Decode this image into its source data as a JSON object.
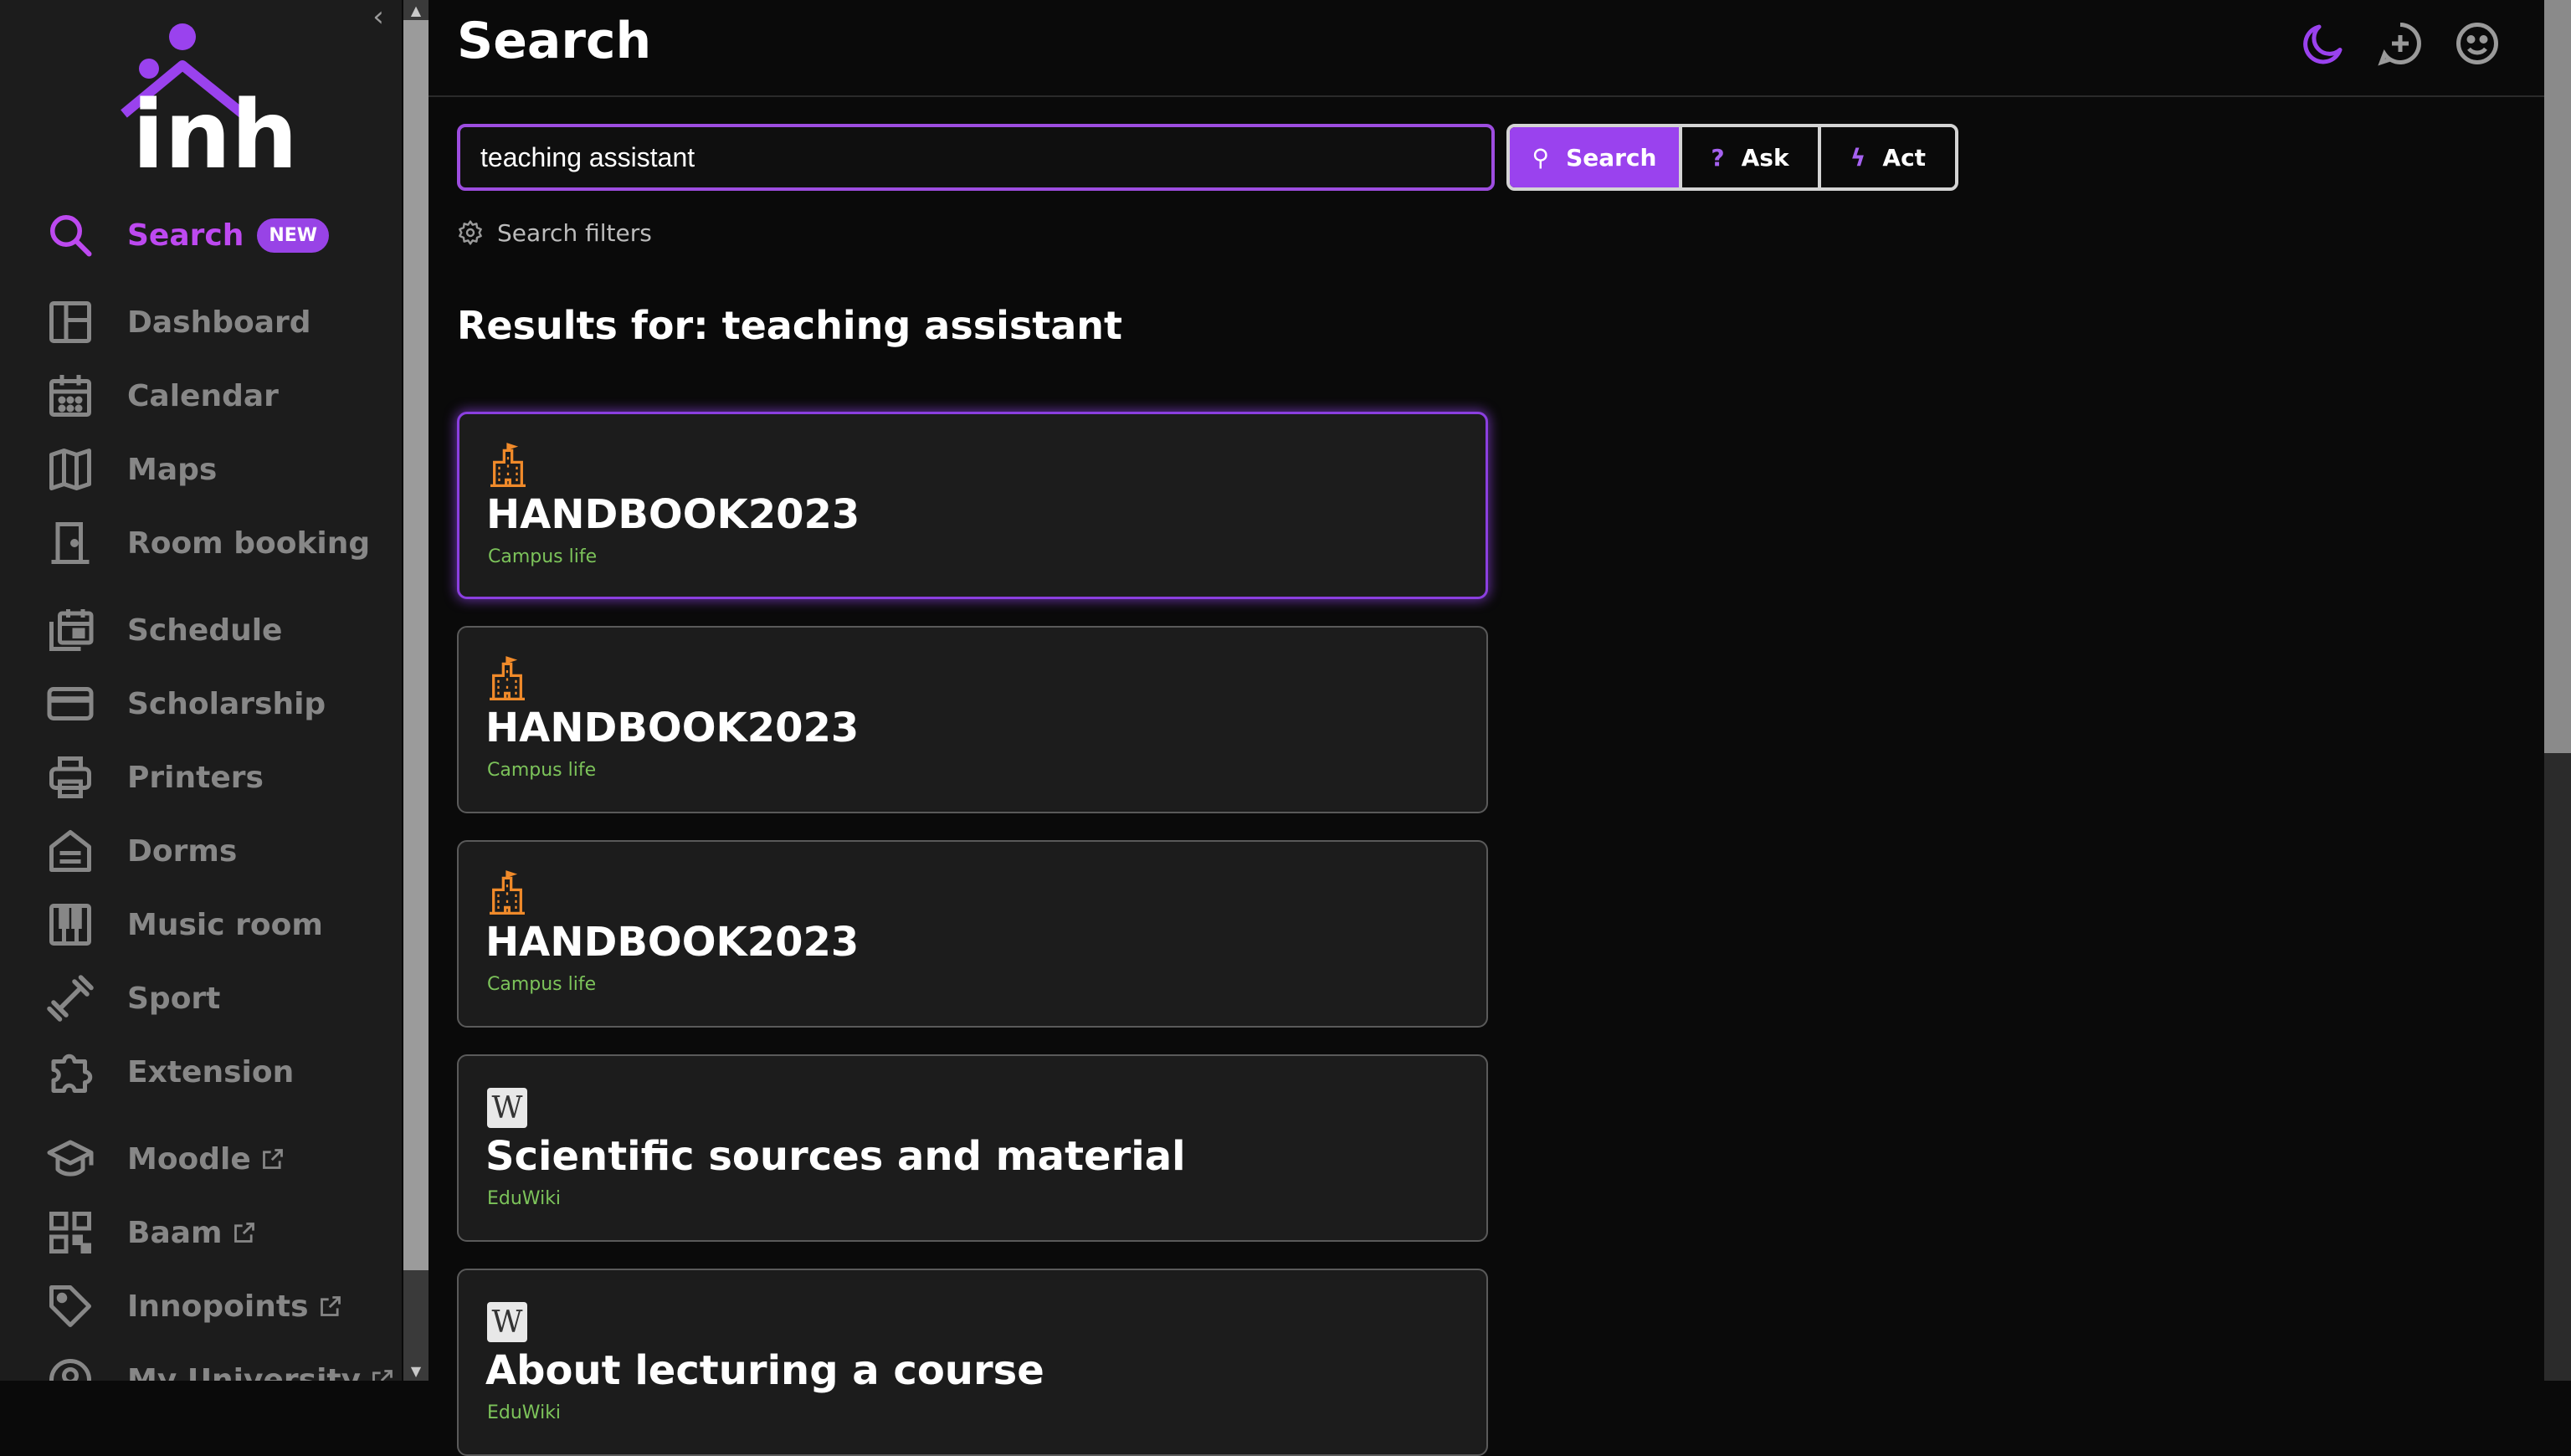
{
  "sidebar": {
    "collapse_glyph": "‹",
    "logo_text": "inh",
    "items": [
      {
        "label": "Search",
        "icon": "search-icon",
        "active": true,
        "badge": "NEW"
      },
      {
        "label": "Dashboard",
        "icon": "dashboard-icon"
      },
      {
        "label": "Calendar",
        "icon": "calendar-icon"
      },
      {
        "label": "Maps",
        "icon": "map-icon"
      },
      {
        "label": "Room booking",
        "icon": "door-icon"
      },
      {
        "label": "Schedule",
        "icon": "schedule-icon"
      },
      {
        "label": "Scholarship",
        "icon": "card-icon"
      },
      {
        "label": "Printers",
        "icon": "printer-icon"
      },
      {
        "label": "Dorms",
        "icon": "dorm-icon"
      },
      {
        "label": "Music room",
        "icon": "piano-icon"
      },
      {
        "label": "Sport",
        "icon": "dumbbell-icon"
      },
      {
        "label": "Extension",
        "icon": "puzzle-icon"
      },
      {
        "label": "Moodle",
        "icon": "graduation-cap-icon",
        "external": true
      },
      {
        "label": "Baam",
        "icon": "qr-code-icon",
        "external": true
      },
      {
        "label": "Innopoints",
        "icon": "tag-icon",
        "external": true
      },
      {
        "label": "My University",
        "icon": "account-circle-icon",
        "external": true
      }
    ]
  },
  "header": {
    "title": "Search",
    "icons": [
      "moon-icon",
      "add-chat-icon",
      "smile-icon"
    ]
  },
  "search": {
    "value": "teaching assistant",
    "placeholder": "",
    "modes": [
      {
        "label": "Search",
        "icon": "search-icon",
        "glyph": "⚲",
        "active": true
      },
      {
        "label": "Ask",
        "icon": "question-icon",
        "glyph": "?"
      },
      {
        "label": "Act",
        "icon": "lightning-icon",
        "glyph": "ϟ"
      }
    ],
    "filters_label": "Search filters"
  },
  "results": {
    "heading": "Results for: teaching assistant",
    "items": [
      {
        "title": "HANDBOOK2023",
        "source": "Campus life",
        "icon": "building-icon"
      },
      {
        "title": "HANDBOOK2023",
        "source": "Campus life",
        "icon": "building-icon"
      },
      {
        "title": "HANDBOOK2023",
        "source": "Campus life",
        "icon": "building-icon"
      },
      {
        "title": "Scientific sources and material",
        "source": "EduWiki",
        "icon": "wiki-icon",
        "glyph": "W"
      },
      {
        "title": "About lecturing a course",
        "source": "EduWiki",
        "icon": "wiki-icon",
        "glyph": "W"
      }
    ]
  },
  "colors": {
    "accent": "#9a42ee",
    "active_nav": "#bd49f0",
    "source_text": "#7cc35a",
    "building_icon": "#f08a2a"
  }
}
